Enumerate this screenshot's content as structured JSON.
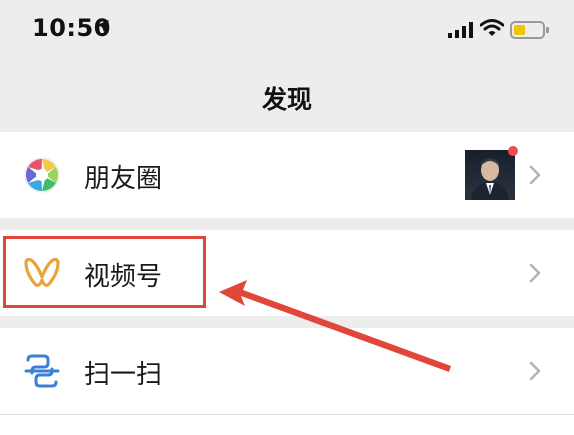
{
  "status_bar": {
    "time": "10:50",
    "icons": [
      "location-arrow-icon",
      "cellular-signal-icon",
      "wifi-icon",
      "battery-icon"
    ]
  },
  "page": {
    "title": "发现"
  },
  "menu": {
    "items": [
      {
        "label": "朋友圈",
        "icon": "moments-icon",
        "has_new_dot": true
      },
      {
        "label": "视频号",
        "icon": "channels-icon",
        "highlighted": true
      },
      {
        "label": "扫一扫",
        "icon": "scan-icon"
      }
    ]
  },
  "colors": {
    "background": "#ededed",
    "row": "#ffffff",
    "highlight": "#e0473a",
    "notification_dot": "#f04c4c",
    "channels_icon": "#e9a33a"
  }
}
